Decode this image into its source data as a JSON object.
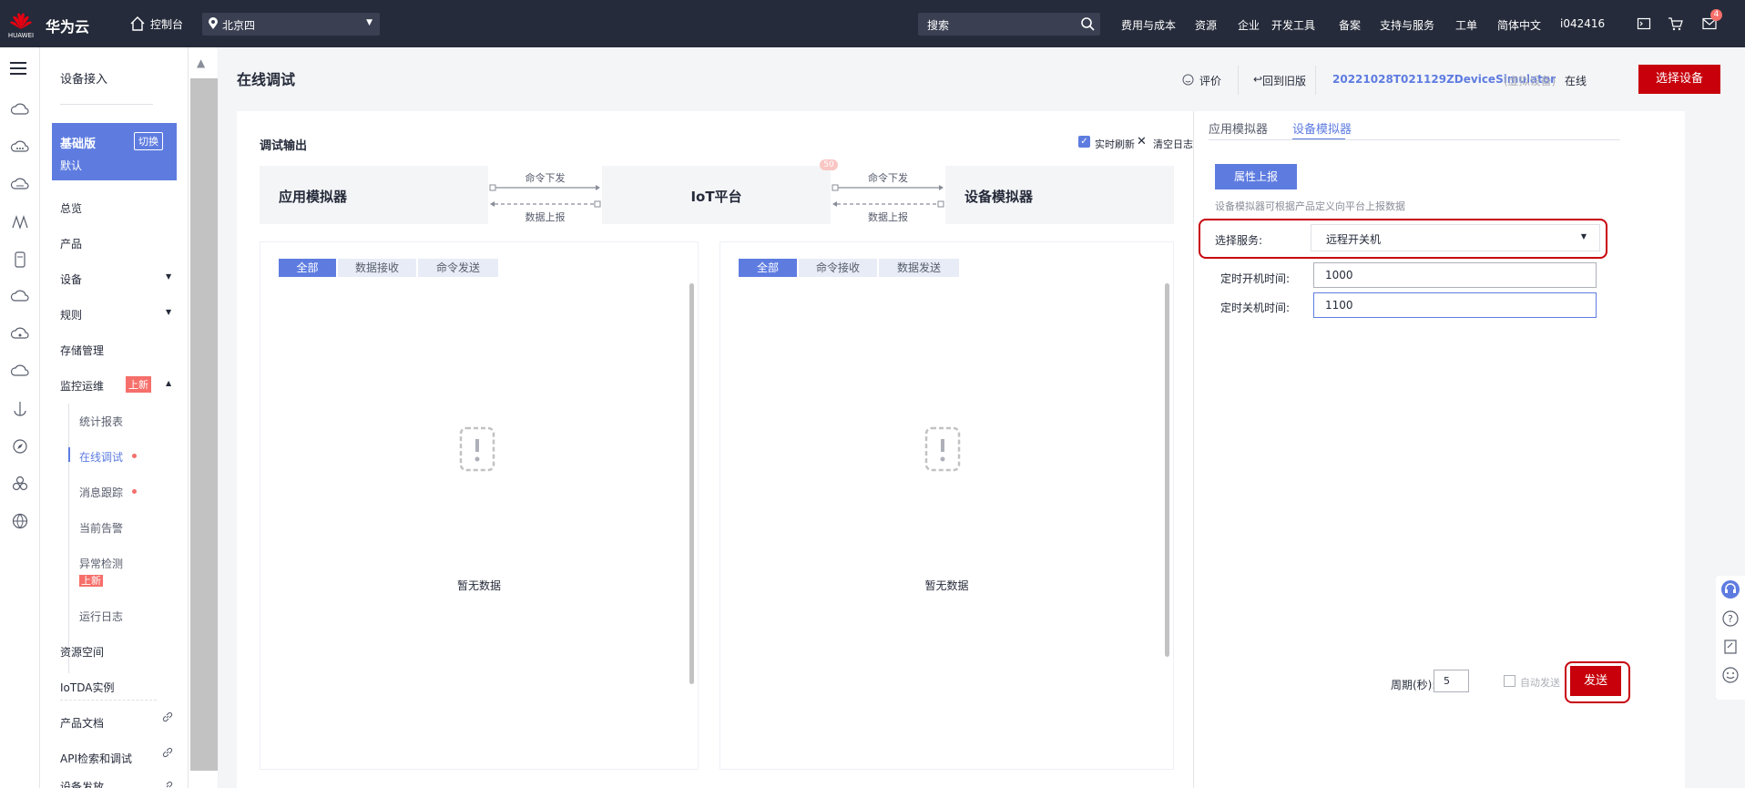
{
  "topbar": {
    "brand_small": "HUAWEI",
    "brand": "华为云",
    "console_label": "控制台",
    "region": "北京四",
    "search_placeholder": "搜索",
    "nav_items": [
      "费用与成本",
      "资源",
      "企业",
      "开发工具",
      "备案",
      "支持与服务",
      "工单",
      "简体中文",
      "i042416"
    ],
    "message_count": "4"
  },
  "sidebar": {
    "title": "设备接入",
    "edition": "基础版",
    "switch_label": "切换",
    "instance": "默认",
    "items": [
      "总览",
      "产品",
      "设备",
      "规则",
      "存储管理",
      "监控运维"
    ],
    "new_badge": "上新",
    "sub_items": [
      "统计报表",
      "在线调试",
      "消息跟踪",
      "当前告警",
      "异常检测",
      "运行日志"
    ],
    "new_badge_2": "上新",
    "after_items": [
      "资源空间",
      "IoTDA实例",
      "产品文档",
      "API检索和调试",
      "设备发放"
    ]
  },
  "page": {
    "title": "在线调试",
    "feedback_label": "评价",
    "back_old_label": "回到旧版",
    "device_name": "20221028T021129ZDeviceSimulator",
    "device_type": "(虚拟设备)",
    "device_status": "在线",
    "select_device_button": "选择设备"
  },
  "debug_output": {
    "title": "调试输出",
    "realtime_refresh": "实时刷新",
    "clear_log": "清空日志",
    "app_simulator": "应用模拟器",
    "iot_platform": "IoT平台",
    "device_simulator": "设备模拟器",
    "cmd_down": "命令下发",
    "data_up": "数据上报",
    "cmd_down_2": "命令下发",
    "data_up_2": "数据上报",
    "badge": "50",
    "left_tabs": [
      "全部",
      "数据接收",
      "命令发送"
    ],
    "right_tabs": [
      "全部",
      "命令接收",
      "数据发送"
    ],
    "empty_text": "暂无数据",
    "empty_text_2": "暂无数据"
  },
  "right_panel": {
    "tabs": [
      "应用模拟器",
      "设备模拟器"
    ],
    "active_tab": "设备模拟器",
    "property_report_button": "属性上报",
    "hint": "设备模拟器可根据产品定义向平台上报数据",
    "select_service_label": "选择服务:",
    "selected_service": "远程开关机",
    "timer_on_label": "定时开机时间:",
    "timer_on_value": "1000",
    "timer_off_label": "定时关机时间:",
    "timer_off_value": "1100",
    "period_label": "周期(秒):",
    "period_value": "5",
    "auto_send_label": "自动发送",
    "send_button": "发送"
  },
  "colors": {
    "topbar": "#252b3a",
    "accent": "#5e7ce0",
    "danger": "#c7000b",
    "badge_red": "#f66f6a"
  }
}
